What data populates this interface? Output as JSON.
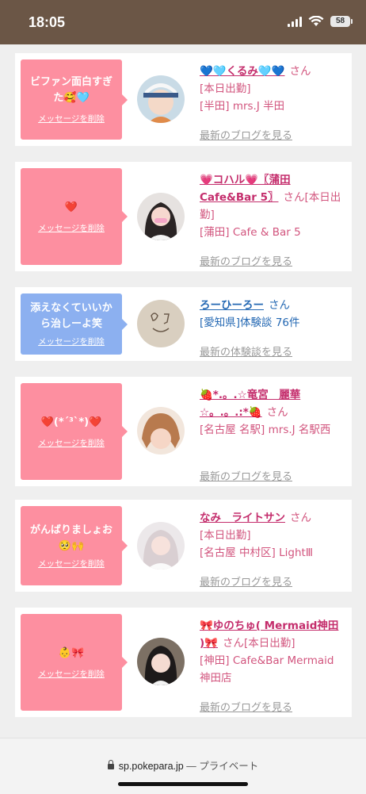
{
  "status_bar": {
    "time": "18:05",
    "battery": "58"
  },
  "cards": [
    {
      "message": "ビファン面白すぎた🥰🩵",
      "delete_label": "メッセージを削除",
      "name": "💙🩵くるみ🩵💙",
      "san": "さん",
      "lines": [
        "[本日出勤]",
        "[半田] mrs.J 半田"
      ],
      "more": "最新のブログを見る",
      "bubble_color": "#fd8fa0"
    },
    {
      "message": "❤️",
      "delete_label": "メッセージを削除",
      "name": "💗コハル💗〖蒲田Cafe&Bar 5〗",
      "san": "さん[本日出勤]",
      "lines": [
        "[蒲田] Cafe & Bar 5"
      ],
      "more": "最新のブログを見る",
      "bubble_color": "#fd8fa0"
    },
    {
      "message": "添えなくていいから治しーよ笑",
      "delete_label": "メッセージを削除",
      "name": "ろーひーろー",
      "san": "さん",
      "lines": [
        "[愛知県]体験談 76件"
      ],
      "more": "最新の体験談を見る",
      "bubble_color": "#8cb0f0"
    },
    {
      "message": "❤️(*´³`*)❤️",
      "delete_label": "メッセージを削除",
      "name": "🍓*.。.☆竜宮　麗華☆。.。.:*🍓",
      "san": "さん",
      "lines": [
        "[名古屋 名駅] mrs.J 名駅西"
      ],
      "more": "最新のブログを見る",
      "bubble_color": "#fd8fa0"
    },
    {
      "message": "がんばりましょお🥺🙌",
      "delete_label": "メッセージを削除",
      "name": "なみ　ライトサン",
      "san": "さん",
      "lines": [
        "[本日出勤]",
        "[名古屋 中村区] LightⅢ"
      ],
      "more": "最新のブログを見る",
      "bubble_color": "#fd8fa0"
    },
    {
      "message": "👶🎀",
      "delete_label": "メッセージを削除",
      "name": "🎀ゆのちゅ( Mermaid神田 )🎀",
      "san": "さん[本日出勤]",
      "lines": [
        "[神田] Cafe&Bar Mermaid 神田店"
      ],
      "more": "最新のブログを見る",
      "bubble_color": "#fd8fa0"
    }
  ],
  "browser": {
    "url": "sp.pokepara.jp",
    "mode": "— プライベート"
  }
}
